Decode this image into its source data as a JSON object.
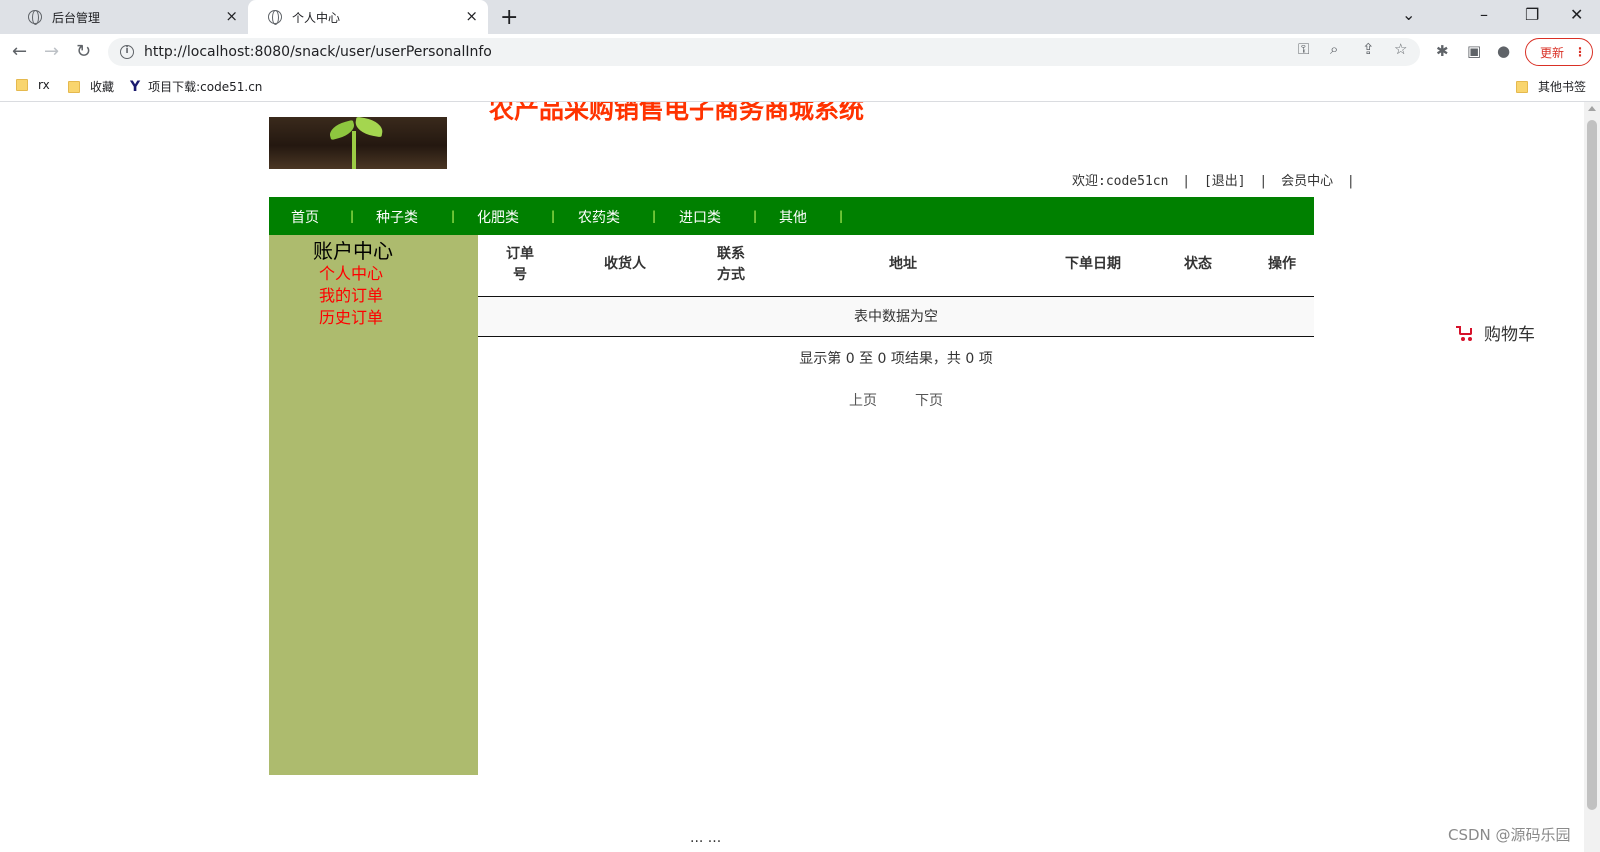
{
  "browser": {
    "tabs": [
      {
        "title": "后台管理",
        "close": "×"
      },
      {
        "title": "个人中心",
        "close": "×"
      }
    ],
    "new_tab": "+",
    "window_controls": {
      "list": "⌄",
      "minimize": "–",
      "restore": "❐",
      "close": "✕"
    },
    "nav": {
      "back": "←",
      "forward": "→",
      "reload": "↻"
    },
    "address": "http://localhost:8080/snack/user/userPersonalInfo",
    "update_label": "更新",
    "update_menu": "⋮",
    "bookmarks": [
      {
        "label": "rx",
        "icon": "folder-icon"
      },
      {
        "label": "收藏",
        "icon": "folder-icon"
      },
      {
        "label": "项目下载:code51.cn",
        "icon": "y-site-icon"
      }
    ],
    "bookmark_logo_char": "Y",
    "other_bookmarks": "其他书签"
  },
  "header": {
    "site_title": "农产品采购销售电子商务商城系统",
    "welcome": "欢迎:code51cn",
    "sep": "|",
    "logout": "[退出]",
    "member_center": "会员中心"
  },
  "nav": {
    "items": [
      "首页",
      "种子类",
      "化肥类",
      "农药类",
      "进口类",
      "其他"
    ],
    "separator": "|"
  },
  "sidebar": {
    "title": "账户中心",
    "links": [
      "个人中心",
      "我的订单",
      "历史订单"
    ]
  },
  "table": {
    "headers": [
      "订单号",
      "收货人",
      "联系方式",
      "地址",
      "下单日期",
      "状态",
      "操作"
    ],
    "header_lines": [
      [
        "订单",
        "号"
      ],
      [
        "收货人"
      ],
      [
        "联系",
        "方式"
      ],
      [
        "地址"
      ],
      [
        "下单日期"
      ],
      [
        "状态"
      ],
      [
        "操作"
      ]
    ],
    "empty_text": "表中数据为空",
    "info": "显示第 0 至 0 项结果，共 0 项",
    "prev": "上页",
    "next": "下页"
  },
  "cart": {
    "label": "购物车",
    "accent": "#d6122b"
  },
  "footer": {
    "partial_text": "... ..."
  },
  "watermark": "CSDN @源码乐园",
  "colors": {
    "title": "#ff3300",
    "nav_bg": "#008000",
    "sidebar_bg": "#adbb6e",
    "sidebar_link": "#ff0000"
  }
}
